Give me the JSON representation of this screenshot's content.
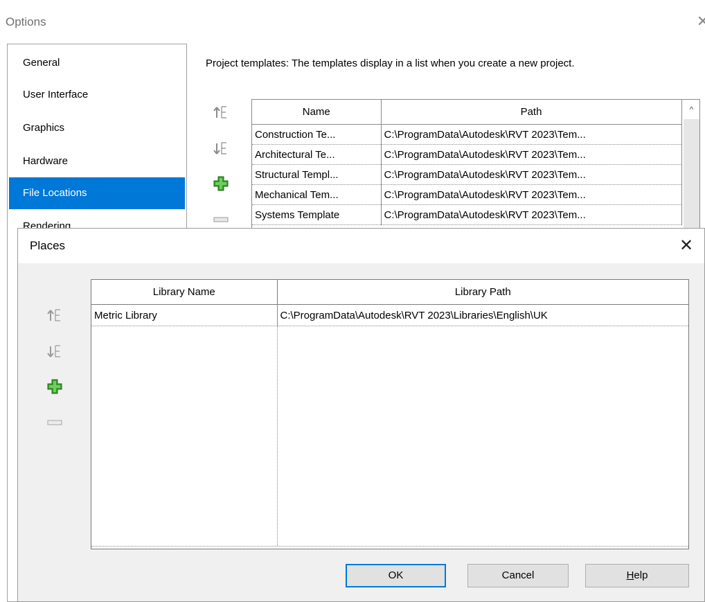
{
  "options": {
    "title": "Options",
    "close_glyph": "✕",
    "sidebar": [
      {
        "label": "General"
      },
      {
        "label": "User Interface"
      },
      {
        "label": "Graphics"
      },
      {
        "label": "Hardware"
      },
      {
        "label": "File Locations",
        "selected": true
      },
      {
        "label": "Rendering"
      }
    ],
    "heading": "Project templates:  The templates display in a list when you create a new project.",
    "templates_table": {
      "columns": [
        "Name",
        "Path"
      ],
      "rows": [
        [
          "Construction Te...",
          "C:\\ProgramData\\Autodesk\\RVT 2023\\Tem..."
        ],
        [
          "Architectural Te...",
          "C:\\ProgramData\\Autodesk\\RVT 2023\\Tem..."
        ],
        [
          "Structural Templ...",
          "C:\\ProgramData\\Autodesk\\RVT 2023\\Tem..."
        ],
        [
          "Mechanical Tem...",
          "C:\\ProgramData\\Autodesk\\RVT 2023\\Tem..."
        ],
        [
          "Systems Template",
          "C:\\ProgramData\\Autodesk\\RVT 2023\\Tem..."
        ]
      ],
      "scroll_up_glyph": "^"
    },
    "toolbar_icons": [
      "move-up-icon",
      "move-down-icon",
      "add-icon",
      "remove-icon"
    ]
  },
  "places": {
    "title": "Places",
    "close_glyph": "✕",
    "table": {
      "columns": [
        "Library Name",
        "Library Path"
      ],
      "rows": [
        [
          "Metric Library",
          "C:\\ProgramData\\Autodesk\\RVT 2023\\Libraries\\English\\UK"
        ]
      ]
    },
    "toolbar_icons": [
      "move-up-icon",
      "move-down-icon",
      "add-icon",
      "remove-icon"
    ],
    "buttons": {
      "ok": "OK",
      "cancel": "Cancel",
      "help": "Help"
    }
  },
  "colors": {
    "accent": "#0078d7",
    "add_icon": "#3a9b2e",
    "icon_gray": "#8a8a8a"
  }
}
